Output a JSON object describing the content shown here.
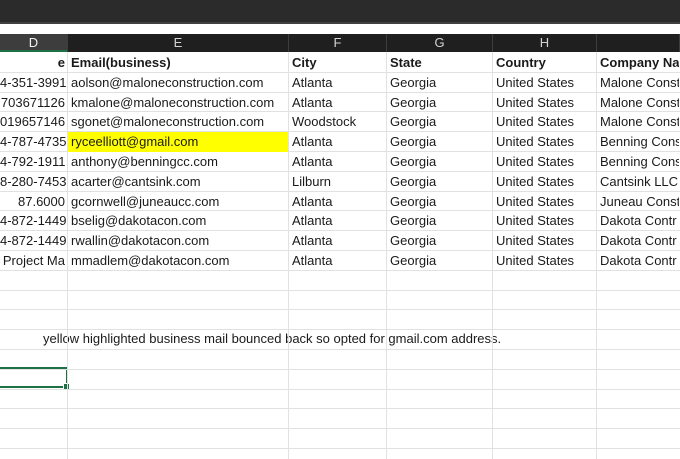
{
  "columns": [
    {
      "letter": "D",
      "selected": true
    },
    {
      "letter": "E",
      "selected": false
    },
    {
      "letter": "F",
      "selected": false
    },
    {
      "letter": "G",
      "selected": false
    },
    {
      "letter": "H",
      "selected": false
    },
    {
      "letter": "",
      "selected": false
    }
  ],
  "headers": [
    "e",
    "Email(business)",
    "City",
    "State",
    "Country",
    "Company Na"
  ],
  "rows": [
    [
      "4-351-3991",
      "aolson@maloneconstruction.com",
      "Atlanta",
      "Georgia",
      "United States",
      "Malone Const"
    ],
    [
      "703671126",
      "kmalone@maloneconstruction.com",
      "Atlanta",
      "Georgia",
      "United States",
      "Malone Const"
    ],
    [
      "019657146",
      "sgonet@maloneconstruction.com",
      "Woodstock",
      "Georgia",
      "United States",
      "Malone Const"
    ],
    [
      "4-787-4735",
      "ryceelliott@gmail.com",
      "Atlanta",
      "Georgia",
      "United States",
      "Benning Cons"
    ],
    [
      "4-792-1911",
      "anthony@benningcc.com",
      "Atlanta",
      "Georgia",
      "United States",
      "Benning Cons"
    ],
    [
      "8-280-7453",
      "acarter@cantsink.com",
      "Lilburn",
      "Georgia",
      "United States",
      "Cantsink LLC"
    ],
    [
      "87.6000",
      "gcornwell@juneaucc.com",
      "Atlanta",
      "Georgia",
      "United States",
      "Juneau Constr"
    ],
    [
      "4-872-1449",
      "bselig@dakotacon.com",
      "Atlanta",
      "Georgia",
      "United States",
      "Dakota Contr"
    ],
    [
      "4-872-1449",
      "rwallin@dakotacon.com",
      "Atlanta",
      "Georgia",
      "United States",
      "Dakota Contr"
    ],
    [
      " Project Ma",
      "mmadlem@dakotacon.com",
      "Atlanta",
      "Georgia",
      "United States",
      "Dakota Contr"
    ]
  ],
  "highlighted_cell": {
    "row": 3,
    "col": 1,
    "color": "#ffff00"
  },
  "note": "yellow highlighted business mail bounced back so opted for gmail.com address.",
  "colors": {
    "header_bg": "#1f1f1f",
    "selected_header_bg": "#3d3d3d",
    "gridline": "#e1e1e1",
    "active_border": "#1e7145",
    "highlight": "#ffff00"
  }
}
